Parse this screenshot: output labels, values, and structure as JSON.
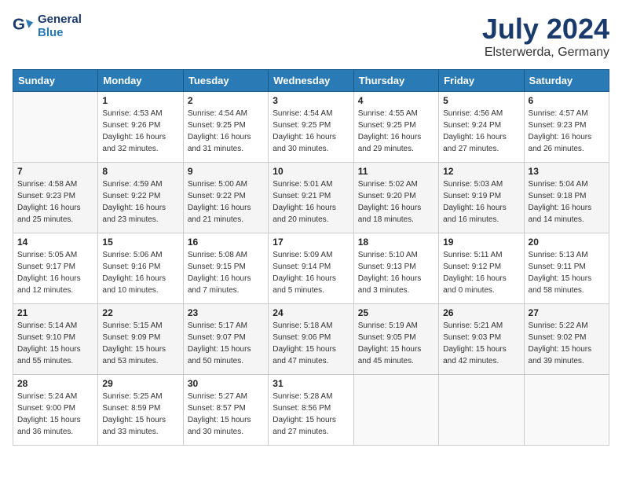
{
  "header": {
    "logo_line1": "General",
    "logo_line2": "Blue",
    "month_title": "July 2024",
    "location": "Elsterwerda, Germany"
  },
  "weekdays": [
    "Sunday",
    "Monday",
    "Tuesday",
    "Wednesday",
    "Thursday",
    "Friday",
    "Saturday"
  ],
  "weeks": [
    [
      {
        "day": "",
        "info": ""
      },
      {
        "day": "1",
        "info": "Sunrise: 4:53 AM\nSunset: 9:26 PM\nDaylight: 16 hours\nand 32 minutes."
      },
      {
        "day": "2",
        "info": "Sunrise: 4:54 AM\nSunset: 9:25 PM\nDaylight: 16 hours\nand 31 minutes."
      },
      {
        "day": "3",
        "info": "Sunrise: 4:54 AM\nSunset: 9:25 PM\nDaylight: 16 hours\nand 30 minutes."
      },
      {
        "day": "4",
        "info": "Sunrise: 4:55 AM\nSunset: 9:25 PM\nDaylight: 16 hours\nand 29 minutes."
      },
      {
        "day": "5",
        "info": "Sunrise: 4:56 AM\nSunset: 9:24 PM\nDaylight: 16 hours\nand 27 minutes."
      },
      {
        "day": "6",
        "info": "Sunrise: 4:57 AM\nSunset: 9:23 PM\nDaylight: 16 hours\nand 26 minutes."
      }
    ],
    [
      {
        "day": "7",
        "info": "Sunrise: 4:58 AM\nSunset: 9:23 PM\nDaylight: 16 hours\nand 25 minutes."
      },
      {
        "day": "8",
        "info": "Sunrise: 4:59 AM\nSunset: 9:22 PM\nDaylight: 16 hours\nand 23 minutes."
      },
      {
        "day": "9",
        "info": "Sunrise: 5:00 AM\nSunset: 9:22 PM\nDaylight: 16 hours\nand 21 minutes."
      },
      {
        "day": "10",
        "info": "Sunrise: 5:01 AM\nSunset: 9:21 PM\nDaylight: 16 hours\nand 20 minutes."
      },
      {
        "day": "11",
        "info": "Sunrise: 5:02 AM\nSunset: 9:20 PM\nDaylight: 16 hours\nand 18 minutes."
      },
      {
        "day": "12",
        "info": "Sunrise: 5:03 AM\nSunset: 9:19 PM\nDaylight: 16 hours\nand 16 minutes."
      },
      {
        "day": "13",
        "info": "Sunrise: 5:04 AM\nSunset: 9:18 PM\nDaylight: 16 hours\nand 14 minutes."
      }
    ],
    [
      {
        "day": "14",
        "info": "Sunrise: 5:05 AM\nSunset: 9:17 PM\nDaylight: 16 hours\nand 12 minutes."
      },
      {
        "day": "15",
        "info": "Sunrise: 5:06 AM\nSunset: 9:16 PM\nDaylight: 16 hours\nand 10 minutes."
      },
      {
        "day": "16",
        "info": "Sunrise: 5:08 AM\nSunset: 9:15 PM\nDaylight: 16 hours\nand 7 minutes."
      },
      {
        "day": "17",
        "info": "Sunrise: 5:09 AM\nSunset: 9:14 PM\nDaylight: 16 hours\nand 5 minutes."
      },
      {
        "day": "18",
        "info": "Sunrise: 5:10 AM\nSunset: 9:13 PM\nDaylight: 16 hours\nand 3 minutes."
      },
      {
        "day": "19",
        "info": "Sunrise: 5:11 AM\nSunset: 9:12 PM\nDaylight: 16 hours\nand 0 minutes."
      },
      {
        "day": "20",
        "info": "Sunrise: 5:13 AM\nSunset: 9:11 PM\nDaylight: 15 hours\nand 58 minutes."
      }
    ],
    [
      {
        "day": "21",
        "info": "Sunrise: 5:14 AM\nSunset: 9:10 PM\nDaylight: 15 hours\nand 55 minutes."
      },
      {
        "day": "22",
        "info": "Sunrise: 5:15 AM\nSunset: 9:09 PM\nDaylight: 15 hours\nand 53 minutes."
      },
      {
        "day": "23",
        "info": "Sunrise: 5:17 AM\nSunset: 9:07 PM\nDaylight: 15 hours\nand 50 minutes."
      },
      {
        "day": "24",
        "info": "Sunrise: 5:18 AM\nSunset: 9:06 PM\nDaylight: 15 hours\nand 47 minutes."
      },
      {
        "day": "25",
        "info": "Sunrise: 5:19 AM\nSunset: 9:05 PM\nDaylight: 15 hours\nand 45 minutes."
      },
      {
        "day": "26",
        "info": "Sunrise: 5:21 AM\nSunset: 9:03 PM\nDaylight: 15 hours\nand 42 minutes."
      },
      {
        "day": "27",
        "info": "Sunrise: 5:22 AM\nSunset: 9:02 PM\nDaylight: 15 hours\nand 39 minutes."
      }
    ],
    [
      {
        "day": "28",
        "info": "Sunrise: 5:24 AM\nSunset: 9:00 PM\nDaylight: 15 hours\nand 36 minutes."
      },
      {
        "day": "29",
        "info": "Sunrise: 5:25 AM\nSunset: 8:59 PM\nDaylight: 15 hours\nand 33 minutes."
      },
      {
        "day": "30",
        "info": "Sunrise: 5:27 AM\nSunset: 8:57 PM\nDaylight: 15 hours\nand 30 minutes."
      },
      {
        "day": "31",
        "info": "Sunrise: 5:28 AM\nSunset: 8:56 PM\nDaylight: 15 hours\nand 27 minutes."
      },
      {
        "day": "",
        "info": ""
      },
      {
        "day": "",
        "info": ""
      },
      {
        "day": "",
        "info": ""
      }
    ]
  ]
}
